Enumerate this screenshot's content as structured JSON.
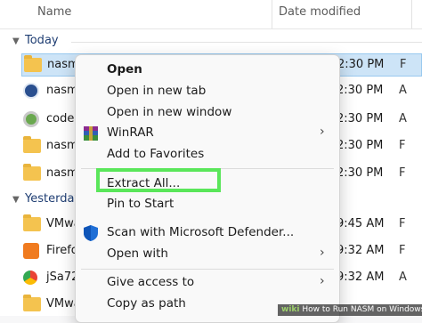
{
  "header": {
    "name_col": "Name",
    "date_col": "Date modified"
  },
  "groups": {
    "today": "Today",
    "yesterday": "Yesterday"
  },
  "files_today": [
    {
      "name": "nasm",
      "time": "2:30 PM",
      "type": "F",
      "icon": "folder-icon",
      "selected": true
    },
    {
      "name": "nasm",
      "time": "2:30 PM",
      "type": "A",
      "icon": "app-icon"
    },
    {
      "name": "codeb",
      "time": "2:30 PM",
      "type": "A",
      "icon": "codeblocks-icon"
    },
    {
      "name": "nasm",
      "time": "2:30 PM",
      "type": "F",
      "icon": "folder-icon"
    },
    {
      "name": "nasm",
      "time": "2:30 PM",
      "type": "F",
      "icon": "folder-icon"
    }
  ],
  "files_yesterday": [
    {
      "name": "VMwa",
      "time": "9:45 AM",
      "type": "F",
      "icon": "folder-icon"
    },
    {
      "name": "Firefo",
      "time": "9:32 AM",
      "type": "F",
      "icon": "firefox-icon"
    },
    {
      "name": "jSa72",
      "time": "9:32 AM",
      "type": "A",
      "icon": "chrome-icon"
    },
    {
      "name": "VMwa",
      "time": "",
      "type": "",
      "icon": "folder-icon"
    }
  ],
  "menu": {
    "items": [
      {
        "label": "Open",
        "bold": true
      },
      {
        "label": "Open in new tab"
      },
      {
        "label": "Open in new window"
      },
      {
        "label": "WinRAR",
        "submenu": true,
        "icon": "winrar-icon"
      },
      {
        "label": "Add to Favorites"
      },
      {
        "label": "Extract All..."
      },
      {
        "label": "Pin to Start"
      },
      {
        "label": "Scan with Microsoft Defender...",
        "icon": "defender-shield-icon"
      },
      {
        "label": "Open with",
        "submenu": true
      },
      {
        "label": "Give access to",
        "submenu": true
      },
      {
        "label": "Copy as path"
      }
    ],
    "submenu_arrow": "›"
  },
  "watermark": {
    "brand": "wiki",
    "text": "How to Run NASM on Windows"
  },
  "colors": {
    "highlight": "#5ae65a",
    "selected_row": "#cde4f7",
    "folder": "#f4c34f"
  }
}
